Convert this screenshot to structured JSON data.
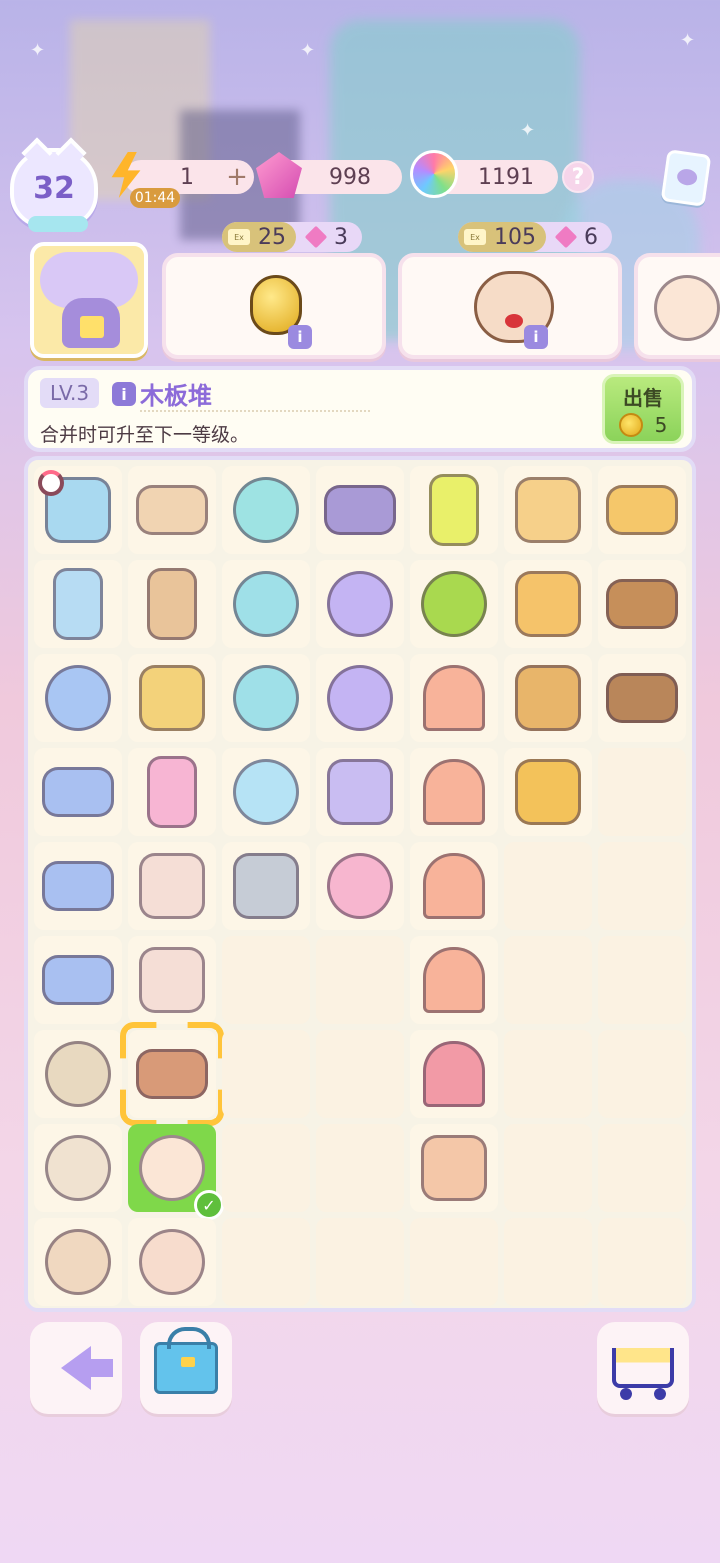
{
  "hud": {
    "player_level": "32",
    "energy": "1",
    "energy_timer": "01:44",
    "energy_plus": "+",
    "gems": "998",
    "stars": "1191",
    "help": "?"
  },
  "orders": [
    {
      "coin_cost": "25",
      "gem_cost": "3",
      "item": "golden-beetle"
    },
    {
      "coin_cost": "105",
      "gem_cost": "6",
      "item": "hamster-with-bow"
    }
  ],
  "selected_item": {
    "level": "LV.3",
    "name": "木板堆",
    "description": "合并时可升至下一等级。",
    "sell_label": "出售",
    "sell_price": "5"
  },
  "board": {
    "rows": [
      [
        {
          "item": "pink-machine",
          "color": "#a9d9f0",
          "timer": true
        },
        {
          "item": "wood-stand",
          "color": "#f1d4b2"
        },
        {
          "item": "teal-mirror",
          "color": "#9ee3e3"
        },
        {
          "item": "purple-book",
          "color": "#a99ad6"
        },
        {
          "item": "firefly-jar",
          "color": "#e9f06a"
        },
        {
          "item": "lantern-box",
          "color": "#f6d08a"
        },
        {
          "item": "flower-basket",
          "color": "#f5c76a"
        }
      ],
      [
        {
          "item": "pet-tower",
          "color": "#b7dcf3"
        },
        {
          "item": "thread-spool",
          "color": "#e9c49a"
        },
        {
          "item": "magnifier",
          "color": "#9fe0e8"
        },
        {
          "item": "purple-device",
          "color": "#c4b4f3"
        },
        {
          "item": "green-pouch",
          "color": "#a9d94f"
        },
        {
          "item": "heart-net",
          "color": "#f5c36a"
        },
        {
          "item": "basket",
          "color": "#c68f5a"
        }
      ],
      [
        {
          "item": "blue-cushion",
          "color": "#a9c6f3"
        },
        {
          "item": "straw-bundle",
          "color": "#f3d27a"
        },
        {
          "item": "small-magnifier",
          "color": "#9fe0e8"
        },
        {
          "item": "satellite-dish",
          "color": "#c4b4f3"
        },
        {
          "item": "coral",
          "color": "#f8b39a"
        },
        {
          "item": "racket-net",
          "color": "#e8b56a"
        },
        {
          "item": "woven-basket",
          "color": "#b9865a"
        }
      ],
      [
        {
          "item": "fabric-rolls",
          "color": "#a9c0f1"
        },
        {
          "item": "pink-spool",
          "color": "#f7b5d3"
        },
        {
          "item": "spinning-top",
          "color": "#b6e3f5"
        },
        {
          "item": "yarn-plug",
          "color": "#c9bdf2"
        },
        {
          "item": "coral",
          "color": "#f8b39a"
        },
        {
          "item": "scissors",
          "color": "#f3c25a"
        },
        {
          "item": "",
          "color": ""
        }
      ],
      [
        {
          "item": "fabric-roll",
          "color": "#a9c0f1"
        },
        {
          "item": "cloth-knot",
          "color": "#f5ded6"
        },
        {
          "item": "anchor",
          "color": "#c6ccd6"
        },
        {
          "item": "hamster-bed",
          "color": "#f7b6cf"
        },
        {
          "item": "coral",
          "color": "#f8b39a"
        },
        {
          "item": "",
          "color": ""
        },
        {
          "item": "",
          "color": ""
        }
      ],
      [
        {
          "item": "fabric-sheet",
          "color": "#a9c0f1"
        },
        {
          "item": "cloth-knot",
          "color": "#f5ded6"
        },
        {
          "item": "",
          "color": ""
        },
        {
          "item": "",
          "color": ""
        },
        {
          "item": "coral",
          "color": "#f8b39a"
        },
        {
          "item": "",
          "color": ""
        },
        {
          "item": "",
          "color": ""
        }
      ],
      [
        {
          "item": "siamese-cat",
          "color": "#e8d9c0"
        },
        {
          "item": "wood-planks",
          "color": "#d89a78",
          "selected": true
        },
        {
          "item": "",
          "color": ""
        },
        {
          "item": "",
          "color": ""
        },
        {
          "item": "small-coral",
          "color": "#f29aa6"
        },
        {
          "item": "",
          "color": ""
        },
        {
          "item": "",
          "color": ""
        }
      ],
      [
        {
          "item": "calico-cat-bed",
          "color": "#f0e2d0"
        },
        {
          "item": "white-cat-bow",
          "color": "#fbe6d6",
          "ready": true
        },
        {
          "item": "",
          "color": ""
        },
        {
          "item": "",
          "color": ""
        },
        {
          "item": "fishing-rod",
          "color": "#f4c7a8"
        },
        {
          "item": "",
          "color": ""
        },
        {
          "item": "",
          "color": ""
        }
      ],
      [
        {
          "item": "calico-cat-eating",
          "color": "#f0d8c0"
        },
        {
          "item": "hamster-bottle",
          "color": "#f7dccd"
        },
        {
          "item": "",
          "color": ""
        },
        {
          "item": "",
          "color": ""
        },
        {
          "item": "",
          "color": ""
        },
        {
          "item": "",
          "color": ""
        },
        {
          "item": "",
          "color": ""
        }
      ]
    ]
  },
  "bottom": {
    "back": "back-arrow-icon",
    "storage": "basket-icon",
    "shop": "cart-icon"
  }
}
